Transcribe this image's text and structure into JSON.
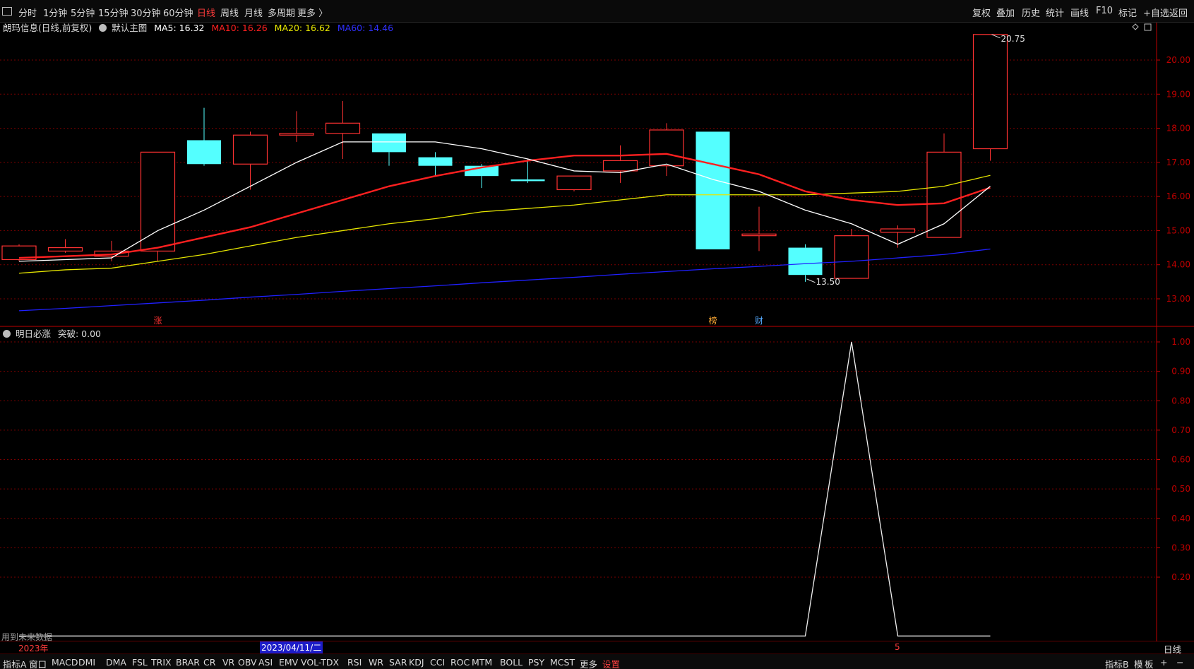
{
  "toolbar": {
    "left_buttons": [
      "分时",
      "1分钟",
      "5分钟",
      "15分钟",
      "30分钟",
      "60分钟",
      "日线",
      "周线",
      "月线",
      "多周期",
      "更多 〉"
    ],
    "active": "日线",
    "right_buttons": [
      "复权",
      "叠加",
      "历史",
      "统计",
      "画线",
      "F10",
      "标记",
      "+自选",
      "返回"
    ]
  },
  "main_header": {
    "title": "朗玛信息(日线,前复权)",
    "theme": "默认主图",
    "ma5": "MA5: 16.32",
    "ma10": "MA10: 16.26",
    "ma20": "MA20: 16.62",
    "ma60": "MA60: 14.46"
  },
  "sub_header": {
    "name": "明日必涨",
    "value": "突破: 0.00"
  },
  "colors": {
    "up": "#ff3232",
    "down": "#54ffff",
    "ma5": "#ffffff",
    "ma10": "#ff2020",
    "ma20": "#e6e600",
    "ma60": "#2020ff",
    "grid": "#7a0000",
    "axis": "#c00000"
  },
  "chart_data": [
    {
      "type": "candlestick",
      "ylim": [
        12.4,
        21.2
      ],
      "yticks": [
        "20.00",
        "19.00",
        "18.00",
        "17.00",
        "16.00",
        "15.00",
        "14.00",
        "13.00"
      ],
      "candles": [
        {
          "o": 14.15,
          "c": 14.55,
          "h": 14.6,
          "l": 14.1
        },
        {
          "o": 14.4,
          "c": 14.5,
          "h": 14.75,
          "l": 14.35
        },
        {
          "o": 14.25,
          "c": 14.4,
          "h": 14.7,
          "l": 14.1
        },
        {
          "o": 14.4,
          "c": 17.3,
          "h": 17.3,
          "l": 14.1
        },
        {
          "o": 17.65,
          "c": 16.95,
          "h": 18.6,
          "l": 16.9
        },
        {
          "o": 16.95,
          "c": 17.8,
          "h": 17.9,
          "l": 16.2
        },
        {
          "o": 17.8,
          "c": 17.85,
          "h": 18.5,
          "l": 17.6
        },
        {
          "o": 17.85,
          "c": 18.15,
          "h": 18.8,
          "l": 17.1
        },
        {
          "o": 17.85,
          "c": 17.3,
          "h": 17.85,
          "l": 16.9
        },
        {
          "o": 17.15,
          "c": 16.9,
          "h": 17.3,
          "l": 16.6
        },
        {
          "o": 16.9,
          "c": 16.6,
          "h": 16.95,
          "l": 16.25
        },
        {
          "o": 16.5,
          "c": 16.45,
          "h": 17.1,
          "l": 16.4
        },
        {
          "o": 16.2,
          "c": 16.6,
          "h": 16.6,
          "l": 16.15
        },
        {
          "o": 16.75,
          "c": 17.05,
          "h": 17.5,
          "l": 16.4
        },
        {
          "o": 16.9,
          "c": 17.95,
          "h": 18.15,
          "l": 16.6
        },
        {
          "o": 17.9,
          "c": 14.45,
          "h": 17.9,
          "l": 14.45
        },
        {
          "o": 14.85,
          "c": 14.9,
          "h": 15.7,
          "l": 14.4
        },
        {
          "o": 14.5,
          "c": 13.7,
          "h": 14.6,
          "l": 13.5
        },
        {
          "o": 13.6,
          "c": 14.85,
          "h": 15.05,
          "l": 13.6
        },
        {
          "o": 14.95,
          "c": 15.05,
          "h": 15.15,
          "l": 14.5
        },
        {
          "o": 14.8,
          "c": 17.3,
          "h": 17.85,
          "l": 14.8
        },
        {
          "o": 17.4,
          "c": 20.75,
          "h": 20.75,
          "l": 17.05
        }
      ],
      "ma5": [
        14.1,
        14.15,
        14.2,
        15.0,
        15.6,
        16.3,
        17.0,
        17.6,
        17.6,
        17.6,
        17.4,
        17.1,
        16.75,
        16.7,
        16.95,
        16.5,
        16.15,
        15.6,
        15.2,
        14.6,
        15.2,
        16.3
      ],
      "ma10": [
        14.2,
        14.25,
        14.3,
        14.5,
        14.8,
        15.1,
        15.5,
        15.9,
        16.3,
        16.6,
        16.85,
        17.05,
        17.2,
        17.2,
        17.25,
        16.95,
        16.65,
        16.15,
        15.9,
        15.75,
        15.8,
        16.26
      ],
      "ma20": [
        13.75,
        13.85,
        13.9,
        14.1,
        14.3,
        14.55,
        14.8,
        15.0,
        15.2,
        15.35,
        15.55,
        15.65,
        15.75,
        15.9,
        16.05,
        16.05,
        16.05,
        16.05,
        16.1,
        16.15,
        16.3,
        16.62
      ],
      "ma60": [
        12.65,
        12.72,
        12.8,
        12.88,
        12.96,
        13.05,
        13.13,
        13.22,
        13.3,
        13.38,
        13.47,
        13.55,
        13.63,
        13.72,
        13.8,
        13.88,
        13.95,
        14.03,
        14.1,
        14.2,
        14.3,
        14.46
      ],
      "annotations": {
        "high": "20.75",
        "low": "13.50"
      },
      "markers": [
        {
          "index": 3,
          "label": "涨",
          "color": "#ff3232"
        },
        {
          "index": 15,
          "label": "榜",
          "color": "#ffaa33"
        },
        {
          "index": 16,
          "label": "财",
          "color": "#55aaff"
        }
      ]
    },
    {
      "type": "line",
      "name": "明日必涨",
      "ylim": [
        0,
        1.0
      ],
      "yticks": [
        "1.00",
        "0.90",
        "0.80",
        "0.70",
        "0.60",
        "0.50",
        "0.40",
        "0.30",
        "0.20"
      ],
      "values": [
        0,
        0,
        0,
        0,
        0,
        0,
        0,
        0,
        0,
        0,
        0,
        0,
        0,
        0,
        0,
        0,
        0,
        0,
        1,
        0,
        0,
        0
      ]
    }
  ],
  "date_strip": {
    "year_label": "2023年",
    "cursor_date": "2023/04/11/二",
    "month_label": "5"
  },
  "note": "用到未来数据",
  "period_label": "日线",
  "bottom_tabs": [
    "指标A",
    "窗口",
    "MACD",
    "DMI",
    "DMA",
    "FSL",
    "TRIX",
    "BRAR",
    "CR",
    "VR",
    "OBV",
    "ASI",
    "EMV",
    "VOL-TDX",
    "RSI",
    "WR",
    "SAR",
    "KDJ",
    "CCI",
    "ROC",
    "MTM",
    "BOLL",
    "PSY",
    "MCST",
    "更多",
    "设置"
  ],
  "bottom_right": [
    "指标B",
    "模",
    "板",
    "+",
    "−"
  ]
}
